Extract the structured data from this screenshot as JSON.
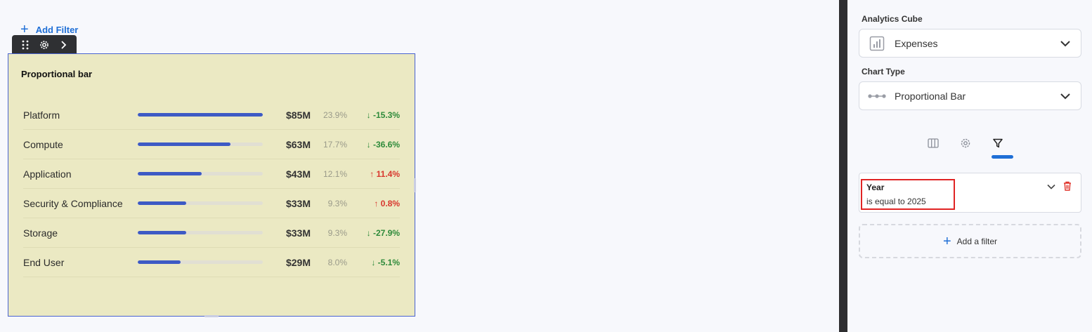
{
  "canvas": {
    "add_filter_label": "Add Filter",
    "toolbar": {
      "icons": [
        "drag-handle-icon",
        "gear-icon",
        "chevron-right-icon"
      ]
    }
  },
  "widget": {
    "title": "Proportional bar",
    "rows": [
      {
        "name": "Platform",
        "value": "$85M",
        "pct": "23.9%",
        "change": "↓ -15.3%",
        "trend": "down",
        "fraction": 1.0
      },
      {
        "name": "Compute",
        "value": "$63M",
        "pct": "17.7%",
        "change": "↓ -36.6%",
        "trend": "down",
        "fraction": 0.74
      },
      {
        "name": "Application",
        "value": "$43M",
        "pct": "12.1%",
        "change": "↑ 11.4%",
        "trend": "up",
        "fraction": 0.51
      },
      {
        "name": "Security & Compliance",
        "value": "$33M",
        "pct": "9.3%",
        "change": "↑ 0.8%",
        "trend": "up",
        "fraction": 0.39
      },
      {
        "name": "Storage",
        "value": "$33M",
        "pct": "9.3%",
        "change": "↓ -27.9%",
        "trend": "down",
        "fraction": 0.39
      },
      {
        "name": "End User",
        "value": "$29M",
        "pct": "8.0%",
        "change": "↓ -5.1%",
        "trend": "down",
        "fraction": 0.34
      }
    ]
  },
  "panel": {
    "analytics_cube": {
      "label": "Analytics Cube",
      "value": "Expenses"
    },
    "chart_type": {
      "label": "Chart Type",
      "value": "Proportional Bar"
    },
    "tabs": [
      {
        "icon": "columns-icon",
        "active": false
      },
      {
        "icon": "gear-icon",
        "active": false
      },
      {
        "icon": "filter-icon",
        "active": true
      }
    ],
    "filter": {
      "name": "Year",
      "description": "is equal to 2025"
    },
    "add_a_filter_label": "Add a filter"
  },
  "colors": {
    "accent": "#1f6fd6",
    "bar": "#3d5ac5",
    "widget_bg": "#ebe9c3",
    "down": "#2e8a3a",
    "up": "#d8362d",
    "highlight": "#e02424"
  }
}
